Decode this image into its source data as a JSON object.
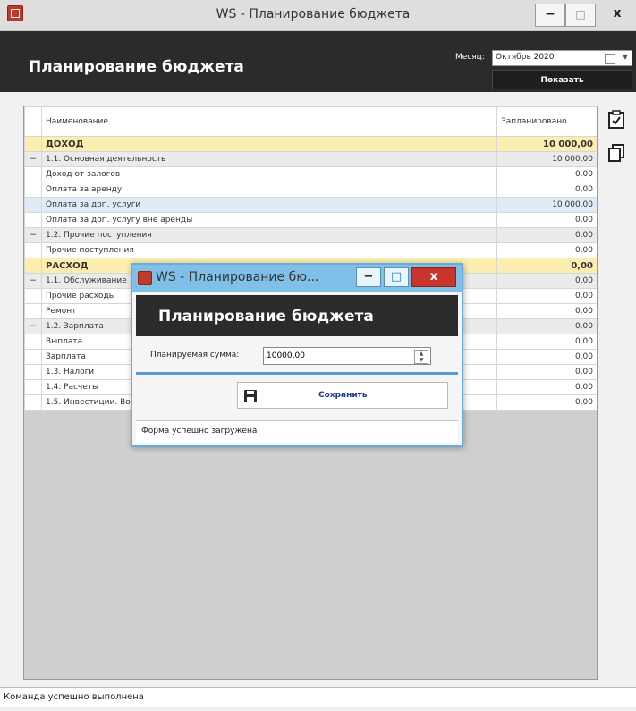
{
  "window": {
    "title": "WS - Планирование бюджета",
    "min_glyph": "−",
    "max_glyph": "□",
    "close_glyph": "x"
  },
  "header": {
    "title": "Планирование бюджета",
    "month_label": "Месяц:",
    "month_value": "Октябрь  2020",
    "show_button": "Показать"
  },
  "grid": {
    "columns": [
      "Наименование",
      "Запланировано"
    ],
    "rows": [
      {
        "sel": "",
        "name": "ДОХОД",
        "amount": "10 000,00",
        "level": 0
      },
      {
        "sel": "−",
        "name": "1.1. Основная деятельность",
        "amount": "10 000,00",
        "level": 1
      },
      {
        "sel": "",
        "name": "Доход от залогов",
        "amount": "0,00",
        "level": 2
      },
      {
        "sel": "",
        "name": "Оплата за аренду",
        "amount": "0,00",
        "level": 2
      },
      {
        "sel": "",
        "name": "Оплата за доп. услуги",
        "amount": "10 000,00",
        "level": 2,
        "highlight": true
      },
      {
        "sel": "",
        "name": "Оплата за доп. услугу вне аренды",
        "amount": "0,00",
        "level": 2
      },
      {
        "sel": "−",
        "name": "1.2. Прочие поступления",
        "amount": "0,00",
        "level": 1
      },
      {
        "sel": "",
        "name": "Прочие поступления",
        "amount": "0,00",
        "level": 2
      },
      {
        "sel": "",
        "name": "РАСХОД",
        "amount": "0,00",
        "level": 0
      },
      {
        "sel": "−",
        "name": "1.1. Обслуживание",
        "amount": "0,00",
        "level": 1
      },
      {
        "sel": "",
        "name": "Прочие расходы",
        "amount": "0,00",
        "level": 2
      },
      {
        "sel": "",
        "name": "Ремонт",
        "amount": "0,00",
        "level": 2
      },
      {
        "sel": "−",
        "name": "1.2. Зарплата",
        "amount": "0,00",
        "level": 1
      },
      {
        "sel": "",
        "name": "Выплата",
        "amount": "0,00",
        "level": 2
      },
      {
        "sel": "",
        "name": "Зарплата",
        "amount": "0,00",
        "level": 2
      },
      {
        "sel": "",
        "name": "1.3. Налоги",
        "amount": "0,00",
        "level": 1,
        "plain": true
      },
      {
        "sel": "",
        "name": "1.4. Расчеты",
        "amount": "0,00",
        "level": 1,
        "plain": true
      },
      {
        "sel": "",
        "name": "1.5. Инвестиции. Вознаграждение инвестора",
        "amount": "0,00",
        "level": 1,
        "plain": true
      }
    ]
  },
  "status": "Команда успешно выполнена",
  "modal": {
    "title": "WS - Планирование бю...",
    "header": "Планирование бюджета",
    "field_label": "Планируемая сумма:",
    "field_value": "10000,00",
    "save_label": "Сохранить",
    "status": "Форма успешно загружена"
  },
  "colors": {
    "header_bg": "#2b2b2b",
    "group_row": "#fbeeb0",
    "highlight_row": "#dfecf7",
    "modal_border": "#6aaddc",
    "close_red": "#c9352b"
  }
}
